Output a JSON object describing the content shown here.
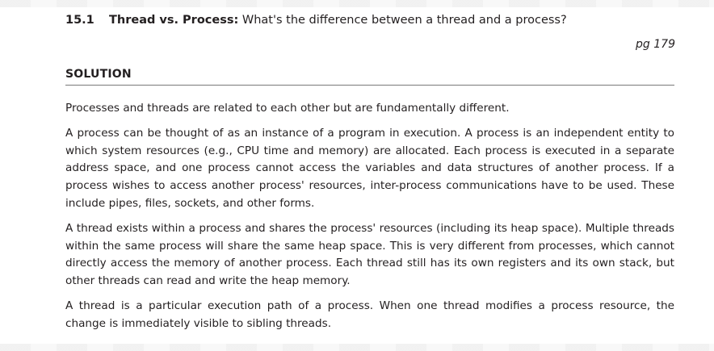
{
  "question": {
    "number": "15.1",
    "title": "Thread vs. Process:",
    "text": " What's the difference between a thread and a process?"
  },
  "page_ref": "pg 179",
  "solution": {
    "heading": "SOLUTION",
    "paragraphs": [
      "Processes and threads are related to each other but are fundamentally different.",
      "A process can be thought of as an instance of a program in execution. A process is an independent entity to which system resources (e.g., CPU time and memory) are allocated. Each process is executed in a separate address space, and one process cannot access the variables and data structures of another process. If a process wishes to access another process' resources, inter-process communications have to be used. These include pipes, files, sockets, and other forms.",
      "A thread exists within a process and shares the process' resources (including its heap space). Multiple threads within the same process will share the same heap space. This is very different from processes, which cannot directly access the memory of another process. Each thread still has its own registers and its own stack, but other threads can read and write the heap memory.",
      "A thread is a particular execution path of a process. When one thread modifies a process resource, the change is immediately visible to sibling threads."
    ]
  }
}
